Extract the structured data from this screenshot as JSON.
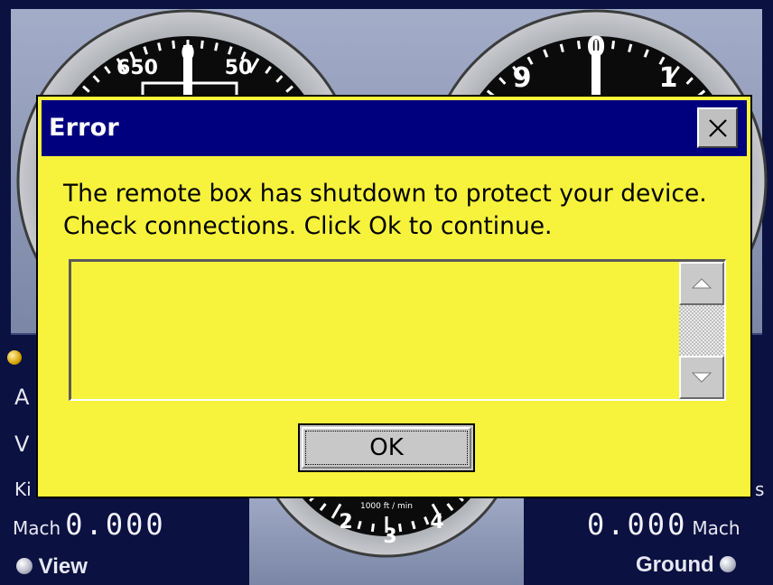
{
  "dialog": {
    "title": "Error",
    "message": "The remote box has shutdown to protect your device. Check connections. Click Ok to continue.",
    "details": "",
    "ok_label": "OK"
  },
  "gauges": {
    "left_top": {
      "labels": [
        "650",
        "0",
        "50"
      ]
    },
    "right_top": {
      "labels": [
        "9",
        "0",
        "1"
      ]
    },
    "bottom_center": {
      "labels": [
        "2",
        "3",
        "4"
      ],
      "unit": "1000 ft / min"
    }
  },
  "left_panel": {
    "labels": [
      "A",
      "V",
      "Ki"
    ],
    "mach_label": "Mach",
    "mach_value": "0.000",
    "view_label": "View"
  },
  "right_panel": {
    "labels": [
      "s"
    ],
    "mach_label": "Mach",
    "mach_value": "0.000",
    "ground_label": "Ground"
  },
  "colors": {
    "dialog_bg": "#f7f33c",
    "titlebar": "#00007f",
    "panel_bg": "#0b1140",
    "bezel": "#8c97b6"
  }
}
